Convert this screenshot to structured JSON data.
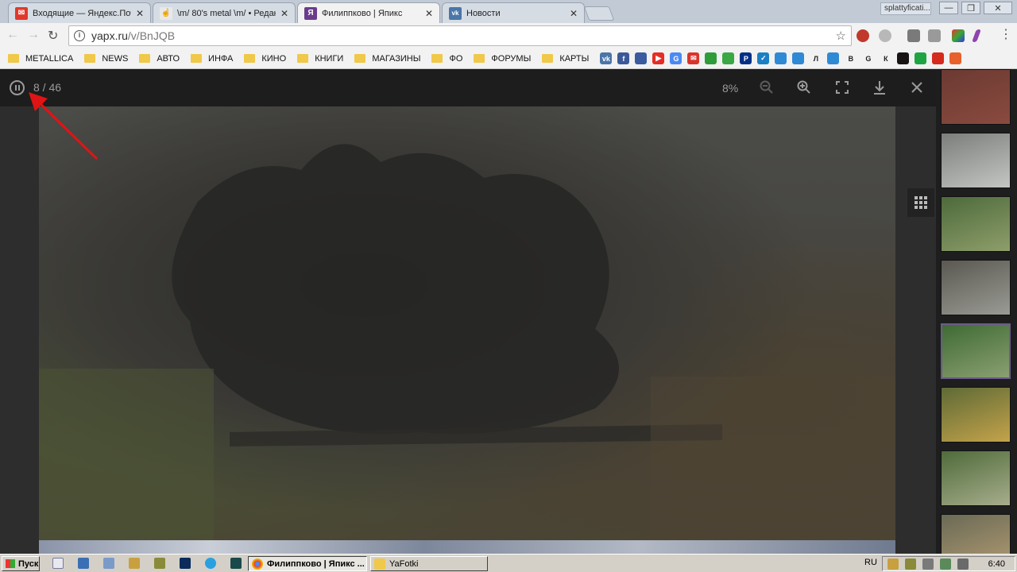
{
  "browser": {
    "tabs": [
      {
        "title": "Входящие — Яндекс.Почта",
        "fav_color": "#e0392b",
        "fav_char": "",
        "close": "✕"
      },
      {
        "title": "\\m/ 80's metal \\m/ • Редак",
        "fav_color": "#c2cad6",
        "fav_char": "",
        "close": "✕"
      },
      {
        "title": "Филиппково | Япикс",
        "fav_color": "#6a3d8c",
        "fav_char": "Я",
        "close": "✕"
      },
      {
        "title": "Новости",
        "fav_color": "#4a76a8",
        "fav_char": "vk",
        "close": "✕"
      }
    ],
    "profile_name": "splattyficati...",
    "window_controls": {
      "minimize": "—",
      "restore": "❐",
      "close": "✕"
    },
    "url_host": "yapx.ru",
    "url_path": "/v/BnJQB"
  },
  "bookmarks": [
    {
      "label": "METALLICA",
      "type": "folder"
    },
    {
      "label": "NEWS",
      "type": "folder"
    },
    {
      "label": "АВТО",
      "type": "folder"
    },
    {
      "label": "ИНФА",
      "type": "folder"
    },
    {
      "label": "КИНО",
      "type": "folder"
    },
    {
      "label": "КНИГИ",
      "type": "folder"
    },
    {
      "label": "МАГАЗИНЫ",
      "type": "folder"
    },
    {
      "label": "ФО",
      "type": "folder"
    },
    {
      "label": "ФОРУМЫ",
      "type": "folder"
    },
    {
      "label": "КАРТЫ",
      "type": "folder"
    }
  ],
  "bookmark_icons": [
    {
      "name": "vk",
      "color": "#4a76a8",
      "char": "vk"
    },
    {
      "name": "facebook",
      "color": "#3b5998",
      "char": "f"
    },
    {
      "name": "person",
      "color": "#3b5ba0",
      "char": ""
    },
    {
      "name": "youtube",
      "color": "#e52d27",
      "char": "▶"
    },
    {
      "name": "translate",
      "color": "#4a8af4",
      "char": "G"
    },
    {
      "name": "mail",
      "color": "#d9342b",
      "char": "✉"
    },
    {
      "name": "green-circle",
      "color": "#2f9c3a",
      "char": ""
    },
    {
      "name": "green-leaf",
      "color": "#39a845",
      "char": ""
    },
    {
      "name": "paypal",
      "color": "#003087",
      "char": "P"
    },
    {
      "name": "check",
      "color": "#1b7fc4",
      "char": "✓"
    },
    {
      "name": "drop-1",
      "color": "#2f8ad6",
      "char": ""
    },
    {
      "name": "drop-2",
      "color": "#2f8ad6",
      "char": ""
    },
    {
      "name": "letter-l",
      "color": "#f2f2f2",
      "char": "Л"
    },
    {
      "name": "drop-3",
      "color": "#2f8ad6",
      "char": ""
    },
    {
      "name": "letter-v",
      "color": "#f2f2f2",
      "char": "В"
    },
    {
      "name": "google",
      "color": "#f2f2f2",
      "char": "G"
    },
    {
      "name": "letter-k",
      "color": "#f2f2f2",
      "char": "К"
    },
    {
      "name": "spotify",
      "color": "#191414",
      "char": ""
    },
    {
      "name": "green-round",
      "color": "#1fa443",
      "char": ""
    },
    {
      "name": "flag-ru",
      "color": "#d52b1e",
      "char": ""
    },
    {
      "name": "shield",
      "color": "#e8602c",
      "char": ""
    }
  ],
  "viewer": {
    "counter": "8 / 46",
    "zoom": "8%"
  },
  "thumbnails": [
    {
      "color_a": "#6b3a32",
      "color_b": "#8a4a3f",
      "active": false
    },
    {
      "color_a": "#7b7e7a",
      "color_b": "#c3c6c2",
      "active": false
    },
    {
      "color_a": "#4d6a3b",
      "color_b": "#8e9e6a",
      "active": false
    },
    {
      "color_a": "#5a5850",
      "color_b": "#9a9b95",
      "active": false
    },
    {
      "color_a": "#3f6a34",
      "color_b": "#8aa070",
      "active": true
    },
    {
      "color_a": "#5e6a36",
      "color_b": "#c4a34a",
      "active": false
    },
    {
      "color_a": "#4f6b3a",
      "color_b": "#a7ad8c",
      "active": false
    },
    {
      "color_a": "#6a6a55",
      "color_b": "#b09a72",
      "active": false
    }
  ],
  "taskbar": {
    "start_label": "Пуск",
    "windows": [
      {
        "label": "Филиппково | Япикс ...",
        "active": true
      },
      {
        "label": "YaFotki",
        "active": false
      }
    ],
    "language": "RU",
    "clock": "6:40"
  }
}
